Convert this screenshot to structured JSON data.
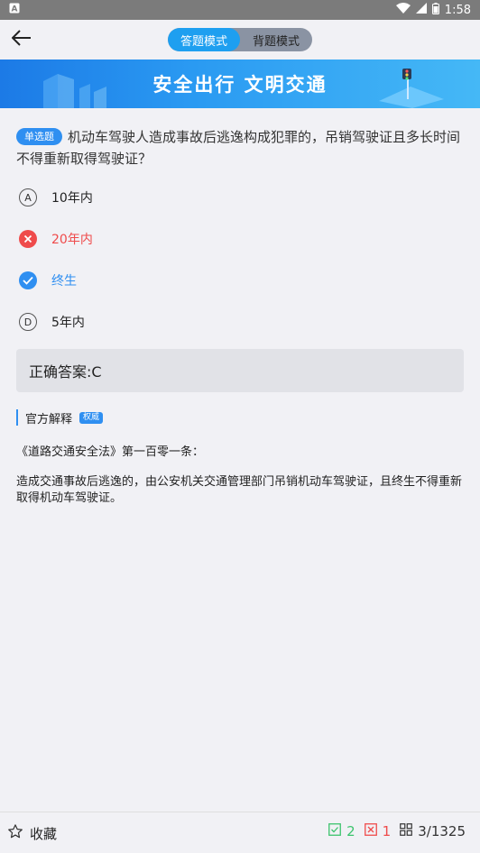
{
  "status_bar": {
    "time": "1:58"
  },
  "mode_toggle": {
    "answer_mode": "答题模式",
    "recite_mode": "背题模式"
  },
  "banner": {
    "text": "安全出行 文明交通"
  },
  "question": {
    "type_tag": "单选题",
    "text": "机动车驾驶人造成事故后逃逸构成犯罪的，吊销驾驶证且多长时间不得重新取得驾驶证？"
  },
  "options": [
    {
      "letter": "A",
      "text": "10年内",
      "state": "normal"
    },
    {
      "letter": "B",
      "text": "20年内",
      "state": "wrong"
    },
    {
      "letter": "C",
      "text": "终生",
      "state": "correct"
    },
    {
      "letter": "D",
      "text": "5年内",
      "state": "normal"
    }
  ],
  "answer": {
    "text": "正确答案:C"
  },
  "explanation": {
    "title": "官方解释",
    "badge": "权威",
    "law": "《道路交通安全法》第一百零一条：",
    "body": "造成交通事故后逃逸的，由公安机关交通管理部门吊销机动车驾驶证，且终生不得重新取得机动车驾驶证。"
  },
  "bottom_bar": {
    "favorite_label": "收藏",
    "correct_count": "2",
    "wrong_count": "1",
    "progress": "3/1325"
  },
  "colors": {
    "accent": "#2f8ff1",
    "wrong": "#ef4b4b",
    "correct_count": "#3cc46d"
  },
  "icons": [
    "back-arrow-icon",
    "wifi-icon",
    "signal-icon",
    "battery-icon",
    "star-icon",
    "check-box-icon",
    "cross-box-icon",
    "grid-icon",
    "wrong-x-icon",
    "correct-check-icon"
  ]
}
